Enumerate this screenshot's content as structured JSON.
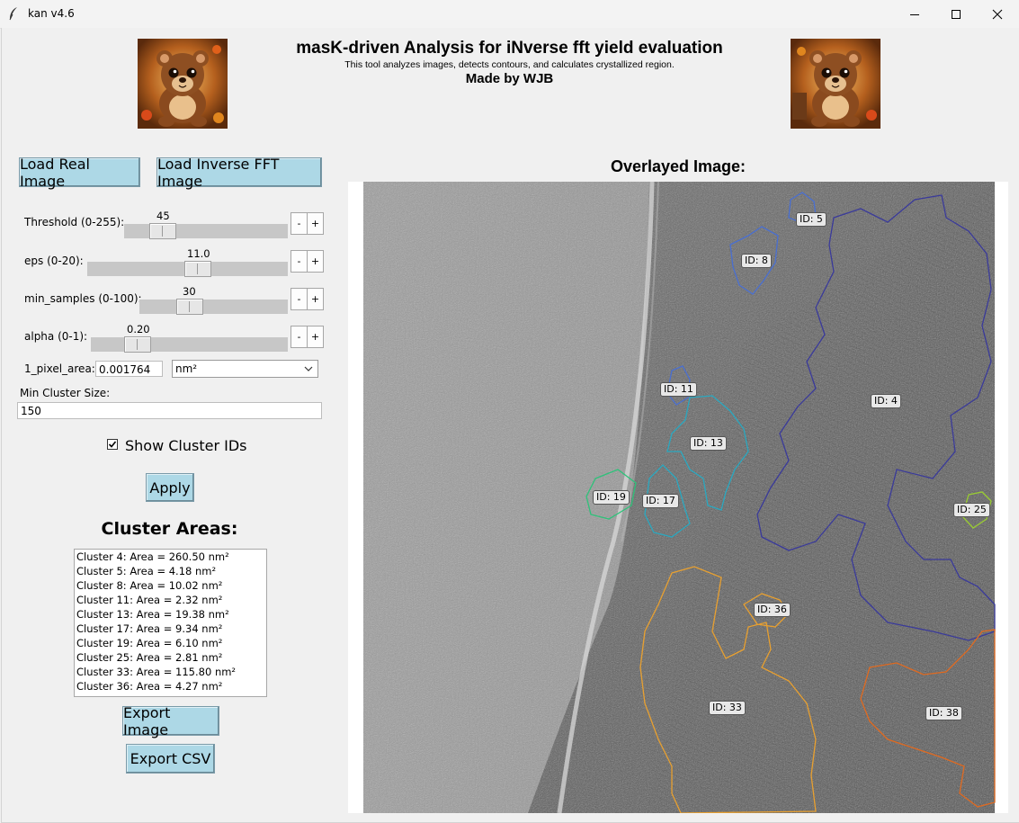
{
  "window": {
    "title": "kan v4.6",
    "controls": [
      "minimize-icon",
      "maximize-icon",
      "close-icon"
    ]
  },
  "header": {
    "title": "masK-driven Analysis for iNverse fft yield evaluation",
    "subtitle": "This tool analyzes images, detects contours, and calculates crystallized region.",
    "author": "Made by WJB"
  },
  "buttons": {
    "load_real": "Load Real Image",
    "load_inverse": "Load Inverse FFT Image",
    "apply": "Apply",
    "export_image": "Export Image",
    "export_csv": "Export CSV",
    "minus": "-",
    "plus": "+"
  },
  "sliders": {
    "threshold": {
      "label": "Threshold (0-255):",
      "value": "45",
      "fraction": 0.176
    },
    "eps": {
      "label": "eps (0-20):",
      "value": "11.0",
      "fraction": 0.55
    },
    "min_samples": {
      "label": "min_samples (0-100):",
      "value": "30",
      "fraction": 0.3
    },
    "alpha": {
      "label": "alpha (0-1):",
      "value": "0.20",
      "fraction": 0.2
    }
  },
  "pixel_area": {
    "label": "1_pixel_area:",
    "value": "0.001764",
    "unit": "nm²"
  },
  "min_cluster": {
    "label": "Min Cluster Size:",
    "value": "150"
  },
  "show_ids": {
    "label": "Show Cluster IDs",
    "checked": true
  },
  "areas": {
    "title": "Cluster Areas:",
    "items": [
      "Cluster 4: Area = 260.50 nm²",
      "Cluster 5: Area = 4.18 nm²",
      "Cluster 8: Area = 10.02 nm²",
      "Cluster 11: Area = 2.32 nm²",
      "Cluster 13: Area = 19.38 nm²",
      "Cluster 17: Area = 9.34 nm²",
      "Cluster 19: Area = 6.10 nm²",
      "Cluster 25: Area = 2.81 nm²",
      "Cluster 33: Area = 115.80 nm²",
      "Cluster 36: Area = 4.27 nm²"
    ]
  },
  "overlay": {
    "title": "Overlayed Image:",
    "labels": [
      "ID: 5",
      "ID: 8",
      "ID: 11",
      "ID: 4",
      "ID: 13",
      "ID: 19",
      "ID: 17",
      "ID: 25",
      "ID: 36",
      "ID: 33",
      "ID: 38"
    ]
  },
  "colors": {
    "button_bg": "#add8e6",
    "cluster_4": "#3a3a9a",
    "cluster_5": "#4a6fd0",
    "cluster_13": "#2aa8c0",
    "cluster_19": "#2ec27a",
    "cluster_25": "#9acd32",
    "cluster_33": "#e8a030",
    "cluster_38": "#e06a20"
  }
}
